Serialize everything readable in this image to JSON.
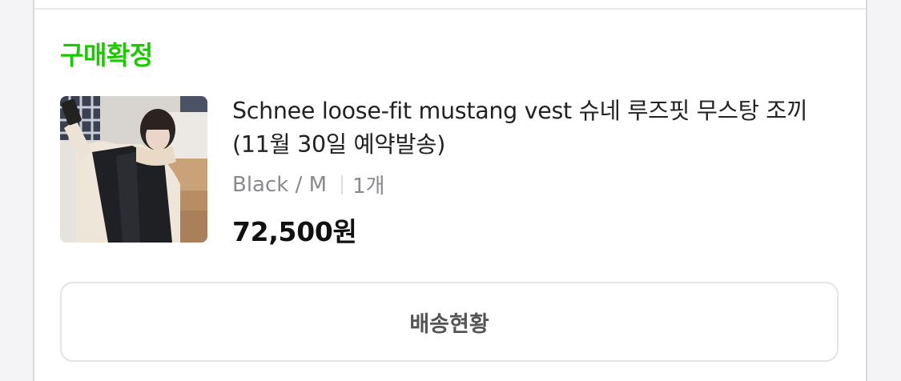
{
  "order": {
    "status_label": "구매확정",
    "product": {
      "title": "Schnee loose-fit mustang vest 슈네 루즈핏 무스탕 조끼 (11월 30일 예약발송)",
      "option": "Black / M",
      "quantity": "1개",
      "price": "72,500원"
    },
    "delivery_button_label": "배송현황"
  },
  "colors": {
    "status_green": "#1ec800",
    "title_text": "#222222",
    "muted_text": "#8a8a8e"
  }
}
